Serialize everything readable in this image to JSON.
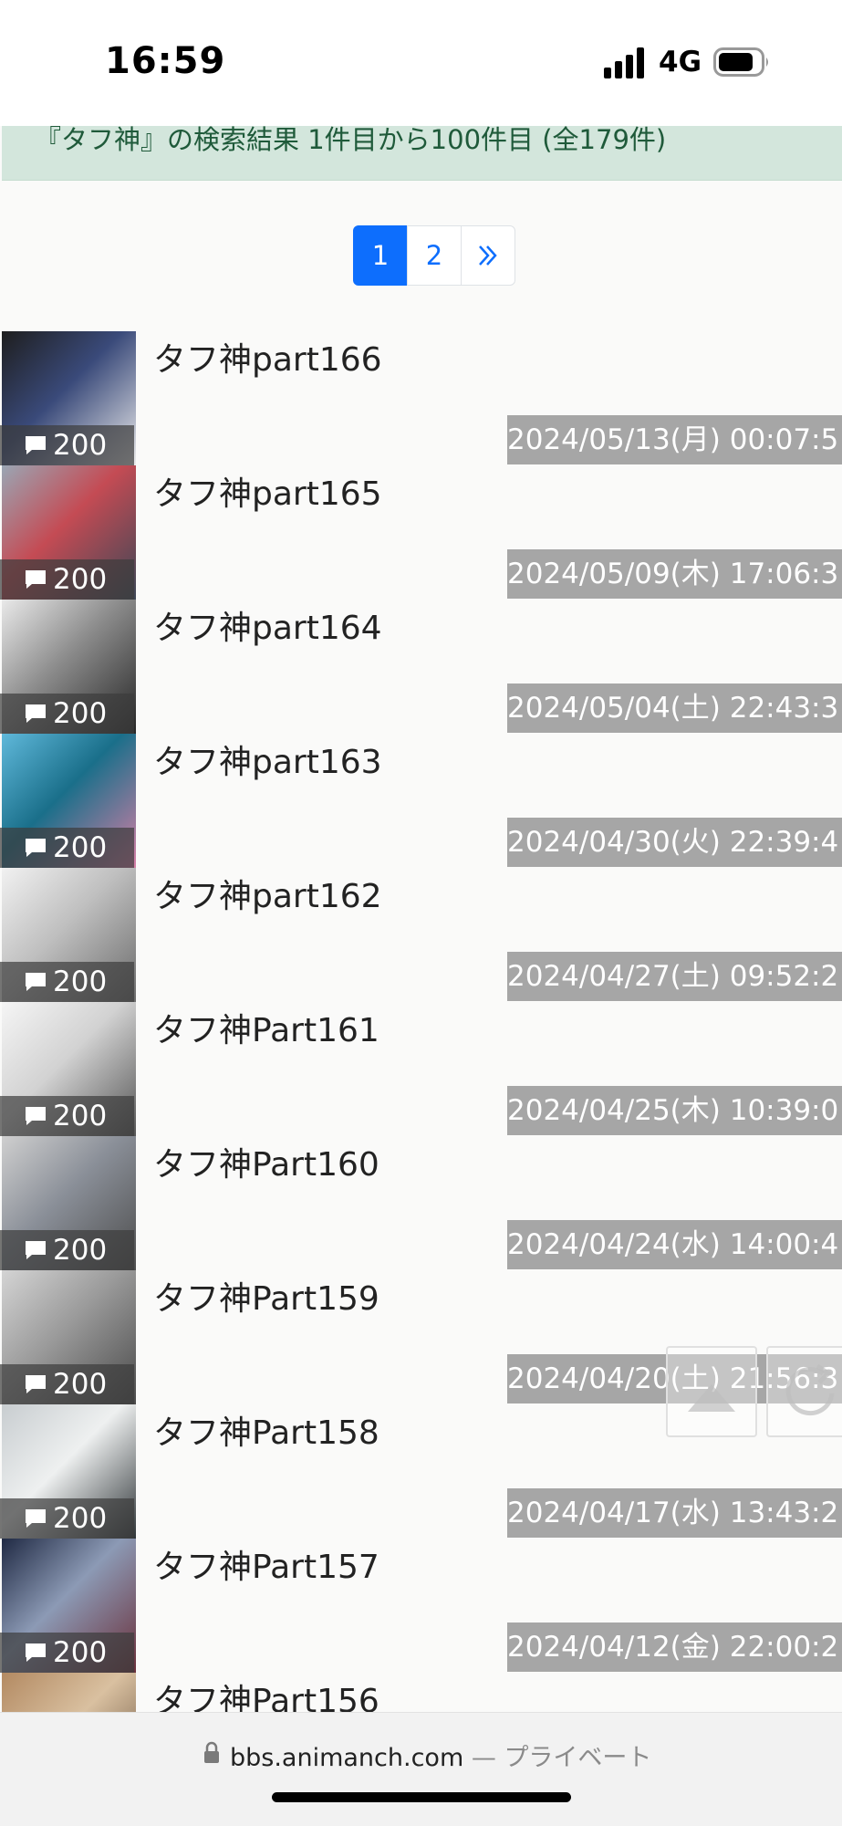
{
  "status_bar": {
    "time": "16:59",
    "network": "4G"
  },
  "search": {
    "summary": "『タフ神』の検索結果 1件目から100件目 (全179件)"
  },
  "pagination": {
    "pages": [
      "1",
      "2"
    ],
    "current": "1",
    "next_label": "»"
  },
  "threads": [
    {
      "title": "タフ神part166",
      "count": "200",
      "date": "2024/05/13(月) 00:07:5",
      "thumb": [
        "#1e1e1e",
        "#ececec",
        "#3a4a7a"
      ]
    },
    {
      "title": "タフ神part165",
      "count": "200",
      "date": "2024/05/09(木) 17:06:3",
      "thumb": [
        "#9aa6b4",
        "#3c4756",
        "#c44b54"
      ]
    },
    {
      "title": "タフ神part164",
      "count": "200",
      "date": "2024/05/04(土) 22:43:3",
      "thumb": [
        "#e9e9e9",
        "#262626",
        "#8c8c8c"
      ]
    },
    {
      "title": "タフ神part163",
      "count": "200",
      "date": "2024/04/30(火) 22:39:4",
      "thumb": [
        "#5fb8da",
        "#d77fa6",
        "#1a6f8a"
      ]
    },
    {
      "title": "タフ神part162",
      "count": "200",
      "date": "2024/04/27(土) 09:52:2",
      "thumb": [
        "#f1f1f1",
        "#6b6b6b",
        "#bfbfbf"
      ]
    },
    {
      "title": "タフ神Part161",
      "count": "200",
      "date": "2024/04/25(木) 10:39:0",
      "thumb": [
        "#f5f5f5",
        "#555555",
        "#d2d2d2"
      ]
    },
    {
      "title": "タフ神Part160",
      "count": "200",
      "date": "2024/04/24(水) 14:00:4",
      "thumb": [
        "#cfcfcf",
        "#4d4d4d",
        "#8a8f98"
      ]
    },
    {
      "title": "タフ神Part159",
      "count": "200",
      "date": "2024/04/20(土) 21:56:3",
      "thumb": [
        "#d4d4d4",
        "#4a4a4a",
        "#9a9a9a"
      ]
    },
    {
      "title": "タフ神Part158",
      "count": "200",
      "date": "2024/04/17(水) 13:43:2",
      "thumb": [
        "#c8cdd0",
        "#2f3538",
        "#eef0f0"
      ]
    },
    {
      "title": "タフ神Part157",
      "count": "200",
      "date": "2024/04/12(金) 22:00:2",
      "thumb": [
        "#202a44",
        "#6a2f3a",
        "#8c9ab5"
      ]
    },
    {
      "title": "タフ神Part156",
      "count": "",
      "date": "",
      "thumb": [
        "#b38a62",
        "#5a4432",
        "#d9c0a0"
      ]
    }
  ],
  "browser": {
    "domain": "bbs.animanch.com",
    "separator": "—",
    "mode": "プライベート"
  },
  "colors": {
    "accent": "#0d6efd",
    "banner_bg": "#d3e6dc",
    "banner_text": "#1f5a3a",
    "date_bg": "#a6a6a6"
  },
  "icons": {
    "comment": "comment-bubble-icon",
    "scroll_top": "arrow-up-icon",
    "reload": "reload-icon",
    "lock": "lock-icon"
  }
}
